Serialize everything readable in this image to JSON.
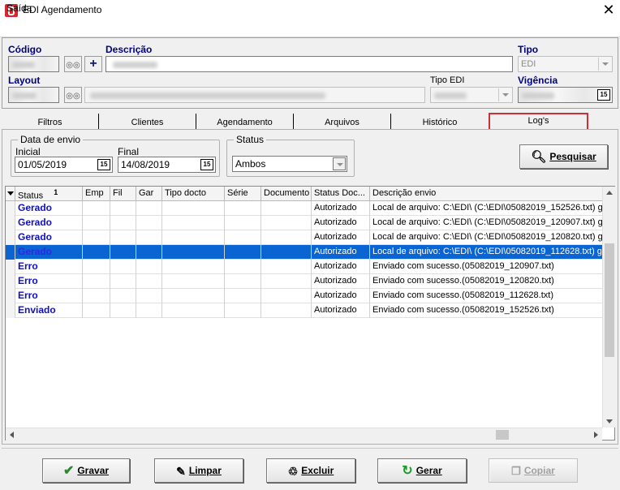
{
  "window": {
    "title": "EDI Agendamento",
    "close_glyph": "✕"
  },
  "menu": {
    "items": [
      "Saída"
    ]
  },
  "header": {
    "codigo_label": "Código",
    "descricao_label": "Descrição",
    "tipo_label": "Tipo",
    "tipo_value": "EDI",
    "layout_label": "Layout",
    "tipo_edi_label": "Tipo EDI",
    "vigencia_label": "Vigência",
    "add_glyph": "+"
  },
  "tabs": [
    "Filtros",
    "Clientes",
    "Agendamento",
    "Arquivos",
    "Histórico",
    "Log's"
  ],
  "active_tab": "Log's",
  "filters": {
    "data_envio_title": "Data de envio",
    "inicial_label": "Inicial",
    "inicial_value": "01/05/2019",
    "final_label": "Final",
    "final_value": "14/08/2019",
    "status_title": "Status",
    "status_value": "Ambos",
    "calendar_glyph": "15",
    "search_button": "Pesquisar"
  },
  "grid": {
    "sort_marker": "1",
    "columns": [
      "Status",
      "Emp",
      "Fil",
      "Gar",
      "Tipo docto",
      "Série",
      "Documento",
      "Status Doc...",
      "Descrição envio"
    ],
    "rows": [
      {
        "status": "Gerado",
        "status_doc": "Autorizado",
        "descricao": "Local de arquivo: C:\\EDI\\ (C:\\EDI\\05082019_152526.txt) g"
      },
      {
        "status": "Gerado",
        "status_doc": "Autorizado",
        "descricao": "Local de arquivo: C:\\EDI\\ (C:\\EDI\\05082019_120907.txt) g"
      },
      {
        "status": "Gerado",
        "status_doc": "Autorizado",
        "descricao": "Local de arquivo: C:\\EDI\\ (C:\\EDI\\05082019_120820.txt) g"
      },
      {
        "status": "Gerado",
        "status_doc": "Autorizado",
        "descricao": "Local de arquivo: C:\\EDI\\ (C:\\EDI\\05082019_112628.txt) g"
      },
      {
        "status": "Erro",
        "status_doc": "Autorizado",
        "descricao": "Enviado com sucesso.(05082019_120907.txt)"
      },
      {
        "status": "Erro",
        "status_doc": "Autorizado",
        "descricao": "Enviado com sucesso.(05082019_120820.txt)"
      },
      {
        "status": "Erro",
        "status_doc": "Autorizado",
        "descricao": "Enviado com sucesso.(05082019_112628.txt)"
      },
      {
        "status": "Enviado",
        "status_doc": "Autorizado",
        "descricao": "Enviado com sucesso.(05082019_152526.txt)"
      }
    ],
    "selected_row": 3
  },
  "buttons": {
    "gravar": "Gravar",
    "limpar": "Limpar",
    "excluir": "Excluir",
    "gerar": "Gerar",
    "copiar": "Copiar"
  },
  "colors": {
    "selection": "#0a64d2",
    "status_text": "#1010c0",
    "label_navy": "#000080",
    "active_tab_border": "#c8303a"
  }
}
